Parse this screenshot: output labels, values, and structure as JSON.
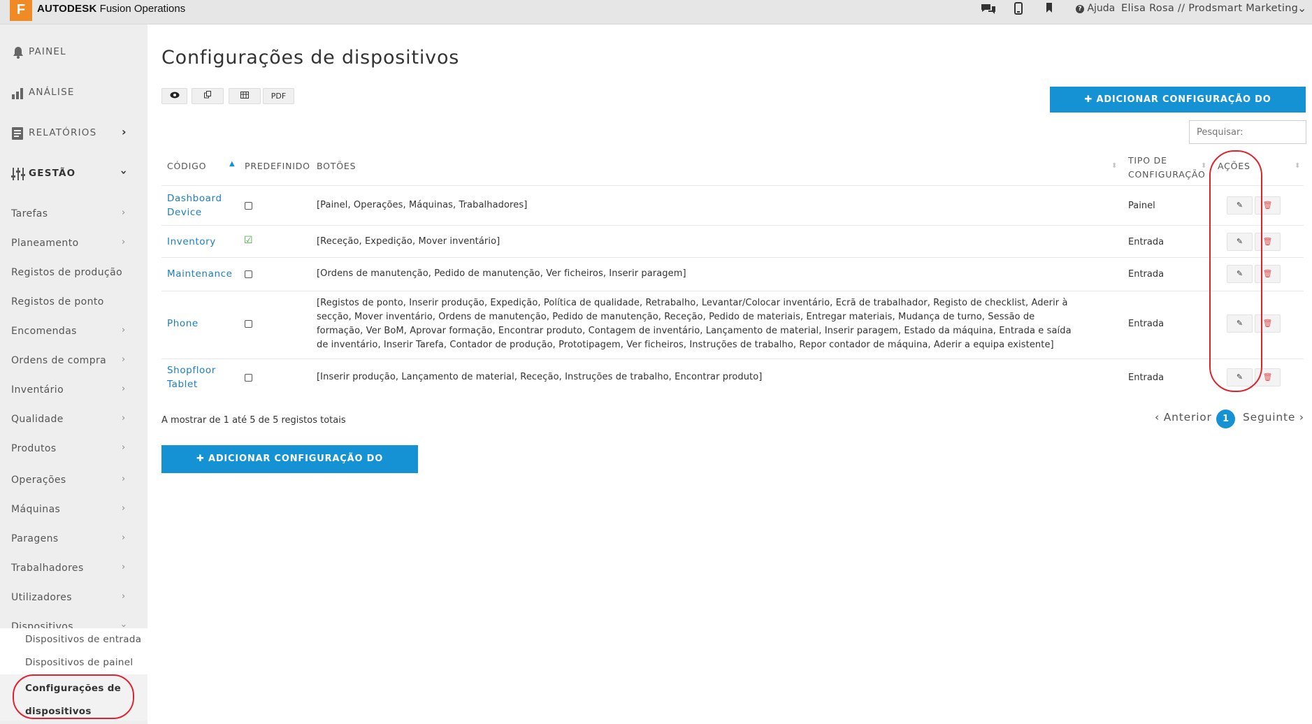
{
  "topbar": {
    "logo_letter": "F",
    "brand_bold": "AUTODESK",
    "brand_rest": " Fusion Operations",
    "help_label": "Ajuda",
    "user_label": "Elisa Rosa // Prodsmart Marketing"
  },
  "sidebar": {
    "main": [
      {
        "label": "PAINEL",
        "icon": "bell-icon"
      },
      {
        "label": "ANÁLISE",
        "icon": "bar-chart-icon"
      },
      {
        "label": "RELATÓRIOS",
        "icon": "document-icon"
      },
      {
        "label": "GESTÃO",
        "icon": "sliders-icon"
      }
    ],
    "sub": [
      {
        "label": "Tarefas"
      },
      {
        "label": "Planeamento"
      },
      {
        "label": "Registos de produção"
      },
      {
        "label": "Registos de ponto"
      },
      {
        "label": "Encomendas"
      },
      {
        "label": "Ordens de compra"
      },
      {
        "label": "Inventário"
      },
      {
        "label": "Qualidade"
      },
      {
        "label": "Produtos"
      },
      {
        "label": "Operações"
      },
      {
        "label": "Máquinas"
      },
      {
        "label": "Paragens"
      },
      {
        "label": "Trabalhadores"
      },
      {
        "label": "Utilizadores"
      },
      {
        "label": "Dispositivos"
      }
    ],
    "devices_sub": [
      {
        "label": "Dispositivos de entrada"
      },
      {
        "label": "Dispositivos de painel"
      },
      {
        "label": "Configurações de dispositivos"
      }
    ]
  },
  "page": {
    "title": "Configurações de dispositivos",
    "tools": {
      "pdf_label": "PDF"
    },
    "add_button_label": "✚ ADICIONAR CONFIGURAÇÃO DO DISPOSITIVO",
    "search_placeholder": "Pesquisar:"
  },
  "table": {
    "headers": {
      "code": "CÓDIGO",
      "default": "PREDEFINIDO",
      "buttons": "BOTÕES",
      "type": "TIPO DE CONFIGURAÇÃO",
      "actions": "AÇÕES"
    },
    "rows": [
      {
        "code": "Dashboard Device",
        "default": false,
        "buttons": "[Painel, Operações, Máquinas, Trabalhadores]",
        "type": "Painel"
      },
      {
        "code": "Inventory",
        "default": true,
        "buttons": "[Receção, Expedição, Mover inventário]",
        "type": "Entrada"
      },
      {
        "code": "Maintenance",
        "default": false,
        "buttons": "[Ordens de manutenção, Pedido de manutenção, Ver ficheiros, Inserir paragem]",
        "type": "Entrada"
      },
      {
        "code": "Phone",
        "default": false,
        "buttons": "[Registos de ponto, Inserir produção, Expedição, Política de qualidade, Retrabalho, Levantar/Colocar inventário, Ecrã de trabalhador, Registo de checklist, Aderir à secção, Mover inventário, Ordens de manutenção, Pedido de manutenção, Receção, Pedido de materiais, Entregar materiais, Mudança de turno, Sessão de formação, Ver BoM, Aprovar formação, Encontrar produto, Contagem de inventário, Lançamento de material, Inserir paragem, Estado da máquina, Entrada e saída de inventário, Inserir Tarefa, Contador de produção, Prototipagem, Ver ficheiros, Instruções de trabalho, Repor contador de máquina, Aderir a equipa existente]",
        "type": "Entrada"
      },
      {
        "code": "Shopfloor Tablet",
        "default": false,
        "buttons": "[Inserir produção, Lançamento de material, Receção, Instruções de trabalho, Encontrar produto]",
        "type": "Entrada"
      }
    ]
  },
  "footer": {
    "info": "A mostrar de 1 até 5 de 5 registos totais",
    "prev": "‹ Anterior",
    "page": "1",
    "next": "Seguinte ›"
  },
  "colors": {
    "accent": "#1592d3",
    "annotation": "#e0222e",
    "brand_orange": "#f08a24"
  }
}
